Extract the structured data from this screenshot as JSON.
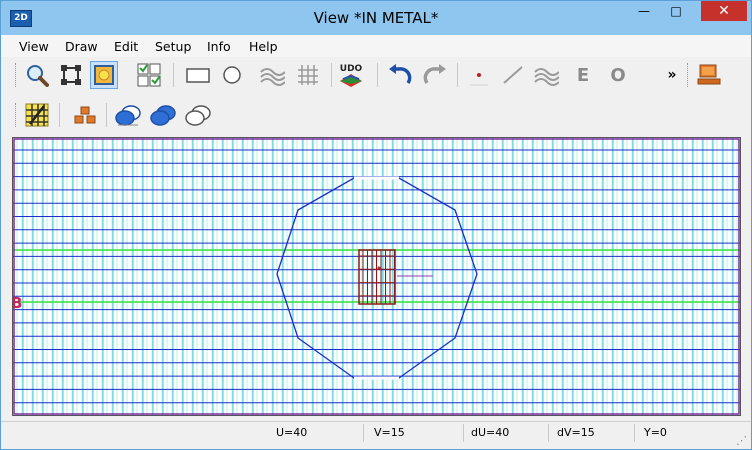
{
  "window": {
    "app_icon_text": "2D",
    "title": "View   *IN METAL*",
    "minimize_glyph": "—",
    "maximize_glyph": "□",
    "close_glyph": "✕"
  },
  "menu": [
    "View",
    "Draw",
    "Edit",
    "Setup",
    "Info",
    "Help"
  ],
  "toolbar": {
    "udo_label": "UDO",
    "e_label": "E",
    "o_label": "O",
    "overflow_glyph": "»"
  },
  "canvas": {
    "axis_label": "B",
    "colors": {
      "grid_dense": "#b9f0e6",
      "grid_cyan": "#44c8e8",
      "grid_blue": "#1b2ec9",
      "grid_green": "#34e034",
      "grid_purple": "#7a2aa0",
      "shape_outline": "#1b2ec9",
      "block_outline": "#8b1a1a"
    }
  },
  "status": {
    "u": "U=40",
    "v": "V=15",
    "du": "dU=40",
    "dv": "dV=15",
    "y": "Y=0"
  }
}
